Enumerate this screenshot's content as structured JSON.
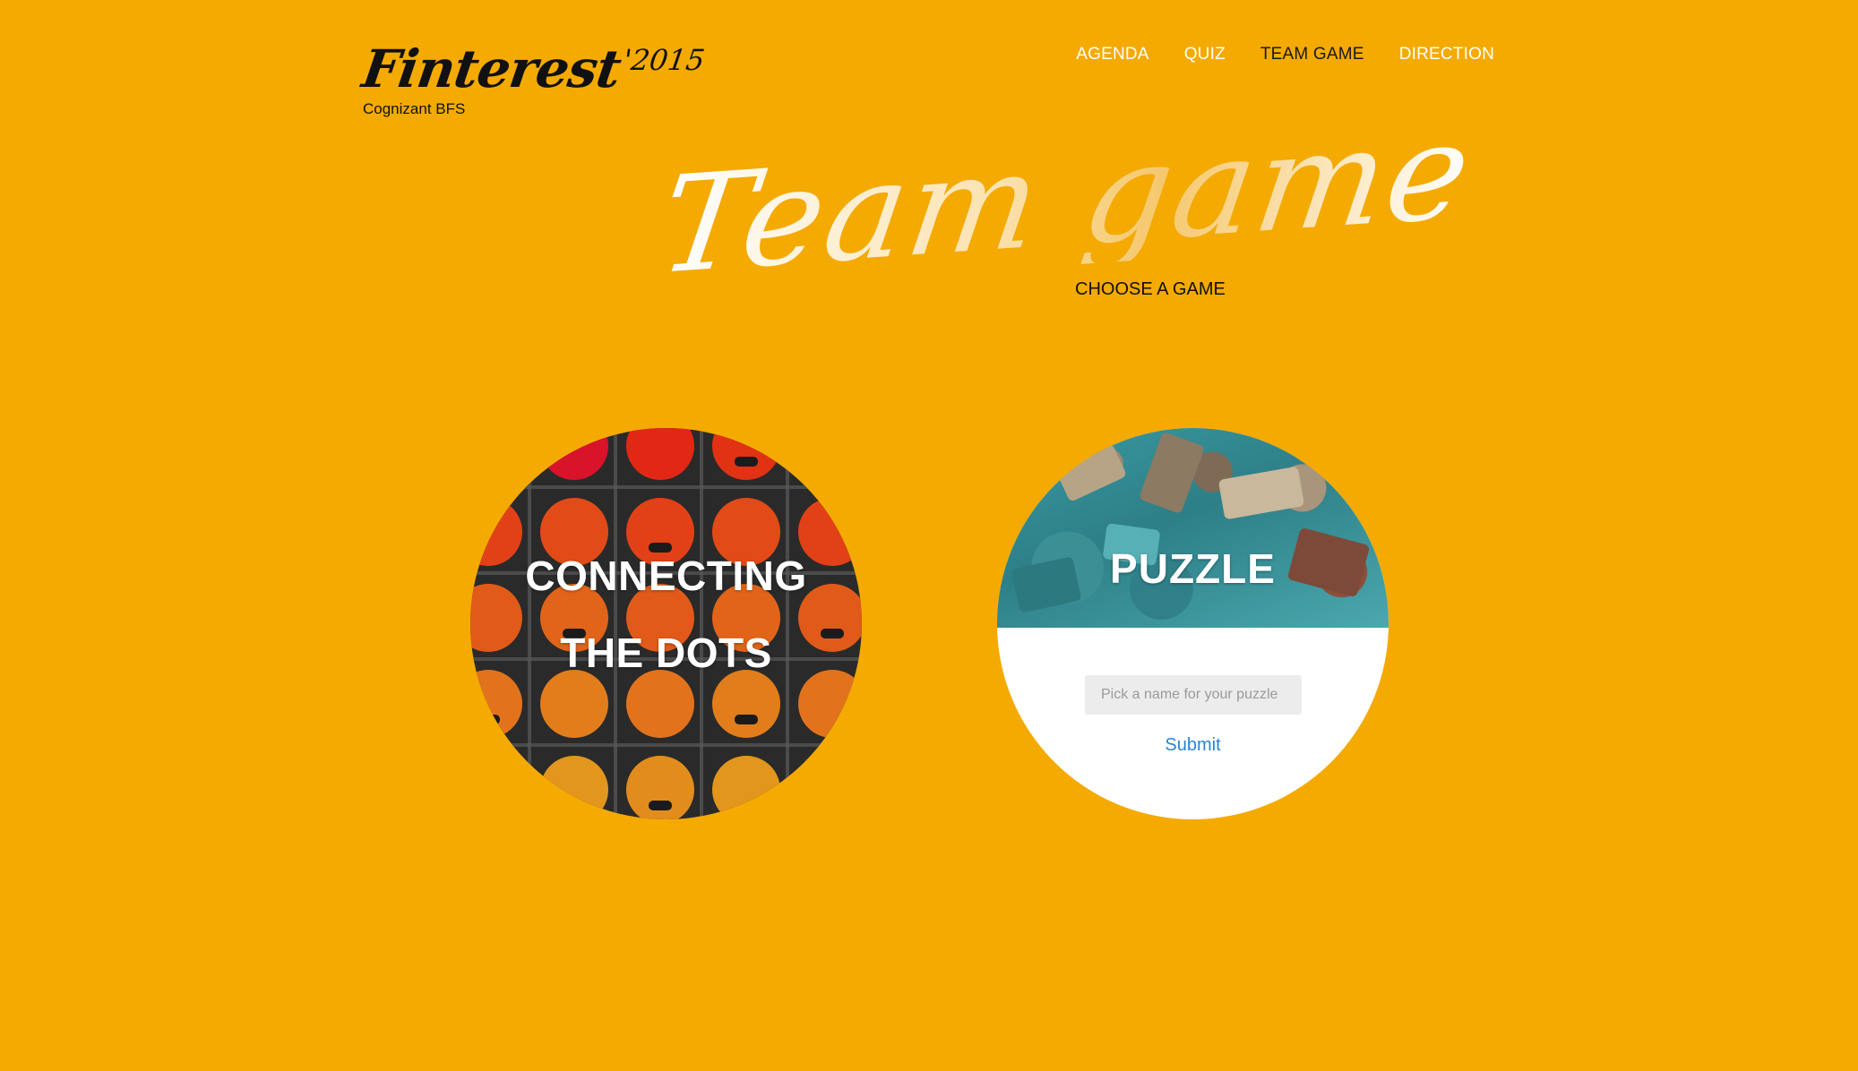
{
  "header": {
    "logo": "Finterest",
    "logo_year": "'2015",
    "subtitle": "Cognizant BFS"
  },
  "nav": [
    {
      "label": "AGENDA",
      "active": false
    },
    {
      "label": "QUIZ",
      "active": false
    },
    {
      "label": "TEAM GAME",
      "active": true
    },
    {
      "label": "DIRECTION",
      "active": false
    }
  ],
  "hero": {
    "title": "Team game",
    "subtitle": "CHOOSE A GAME"
  },
  "games": {
    "connect": {
      "title_line1": "CONNECTING",
      "title_line2": "THE DOTS"
    },
    "puzzle": {
      "title": "PUZZLE",
      "input_placeholder": "Pick a name for your puzzle",
      "submit_label": "Submit"
    }
  },
  "colors": {
    "background": "#F4AA00",
    "link": "#2a84d2",
    "nav_active": "#1a1a1a"
  }
}
